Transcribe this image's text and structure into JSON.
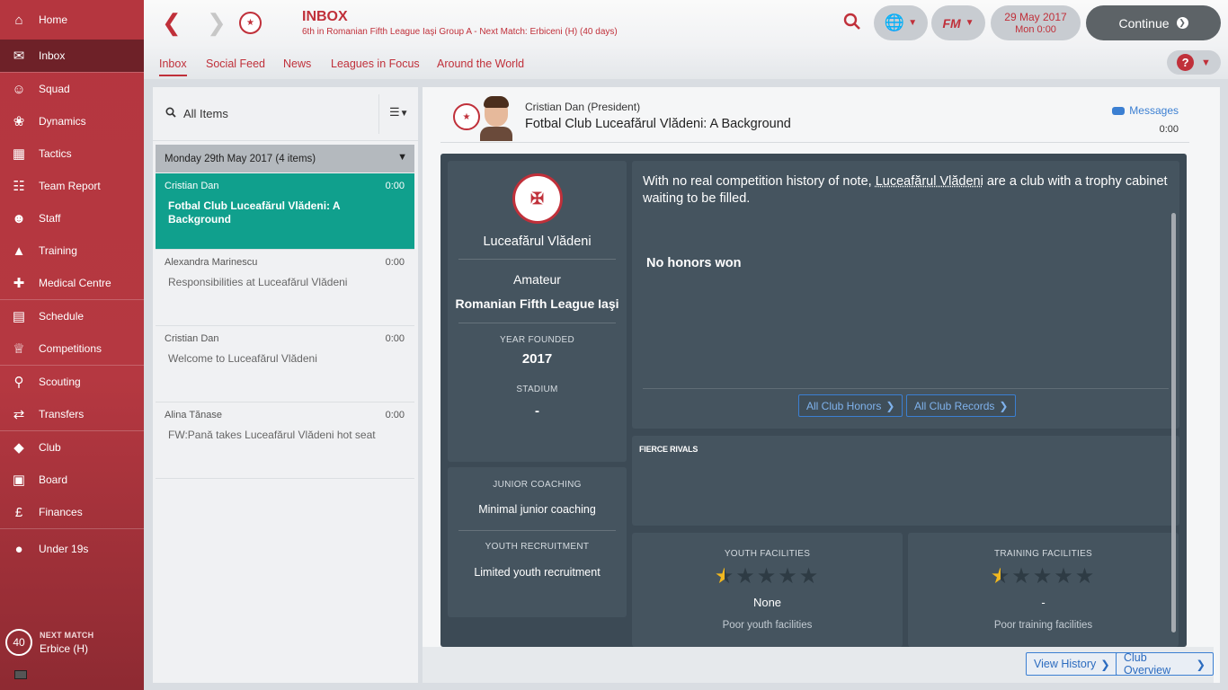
{
  "sidebar": {
    "items": [
      {
        "label": "Home",
        "icon": "home-icon"
      },
      {
        "label": "Inbox",
        "icon": "inbox-icon",
        "active": true
      },
      {
        "label": "Squad",
        "icon": "squad-icon"
      },
      {
        "label": "Dynamics",
        "icon": "dynamics-icon"
      },
      {
        "label": "Tactics",
        "icon": "tactics-icon"
      },
      {
        "label": "Team Report",
        "icon": "team-report-icon"
      },
      {
        "label": "Staff",
        "icon": "staff-icon"
      },
      {
        "label": "Training",
        "icon": "training-icon"
      },
      {
        "label": "Medical Centre",
        "icon": "medical-icon"
      },
      {
        "label": "Schedule",
        "icon": "schedule-icon"
      },
      {
        "label": "Competitions",
        "icon": "trophy-icon"
      },
      {
        "label": "Scouting",
        "icon": "scouting-icon"
      },
      {
        "label": "Transfers",
        "icon": "transfers-icon"
      },
      {
        "label": "Club",
        "icon": "club-icon"
      },
      {
        "label": "Board",
        "icon": "board-icon"
      },
      {
        "label": "Finances",
        "icon": "finances-icon"
      },
      {
        "label": "Under 19s",
        "icon": "u19-icon"
      }
    ],
    "next_match": {
      "title": "NEXT MATCH",
      "days": "40",
      "team": "Erbice (H)"
    }
  },
  "topbar": {
    "title": "INBOX",
    "subtitle": "6th in Romanian Fifth League Iaşi Group A - Next Match: Erbiceni (H) (40 days)",
    "fm_label": "FM",
    "date": "29 May 2017",
    "day_time": "Mon 0:00",
    "continue": "Continue"
  },
  "tabs": [
    "Inbox",
    "Social Feed",
    "News",
    "Leagues in Focus",
    "Around the World"
  ],
  "help": "?",
  "list": {
    "filter": "All Items",
    "group": "Monday 29th May 2017 (4 items)",
    "messages": [
      {
        "from": "Cristian Dan",
        "time": "0:00",
        "subject": "Fotbal Club Luceafărul Vlădeni: A Background"
      },
      {
        "from": "Alexandra Marinescu",
        "time": "0:00",
        "subject": "Responsibilities at Luceafărul Vlădeni"
      },
      {
        "from": "Cristian Dan",
        "time": "0:00",
        "subject": "Welcome to Luceafărul Vlădeni"
      },
      {
        "from": "Alina Tănase",
        "time": "0:00",
        "subject": "FW:Pană takes Luceafărul Vlădeni hot seat"
      }
    ]
  },
  "message": {
    "sender": "Cristian Dan",
    "role": "(President)",
    "subject": "Fotbal Club Luceafărul Vlădeni: A Background",
    "messages_link": "Messages",
    "time": "0:00"
  },
  "club": {
    "name": "Luceafărul Vlădeni",
    "status": "Amateur",
    "league": "Romanian Fifth League Iaşi",
    "year_founded_label": "YEAR FOUNDED",
    "year_founded": "2017",
    "stadium_label": "STADIUM",
    "stadium": "-",
    "junior_label": "JUNIOR COACHING",
    "junior": "Minimal junior coaching",
    "youth_rec_label": "YOUTH RECRUITMENT",
    "youth_rec": "Limited youth recruitment"
  },
  "description": {
    "before": "With no real competition history of note, ",
    "club_link": "Luceafărul Vlădeni",
    "after": " are a club with a trophy cabinet waiting to be filled.",
    "honors": "No honors won",
    "btn_honors": "All Club Honors",
    "btn_records": "All Club Records"
  },
  "rivals": {
    "title": "FIERCE RIVALS"
  },
  "facilities": {
    "youth": {
      "title": "YOUTH FACILITIES",
      "rating": 0.5,
      "max": 5,
      "value": "None",
      "desc": "Poor youth facilities"
    },
    "training": {
      "title": "TRAINING FACILITIES",
      "rating": 0.5,
      "max": 5,
      "value": "-",
      "desc": "Poor training facilities"
    }
  },
  "bottom": {
    "history": "View History",
    "overview": "Club Overview"
  },
  "colors": {
    "accent": "#c0303a",
    "selected": "#10a08d",
    "panel": "#3c4a55",
    "link": "#3b7fd2",
    "star": "#f1b820"
  }
}
